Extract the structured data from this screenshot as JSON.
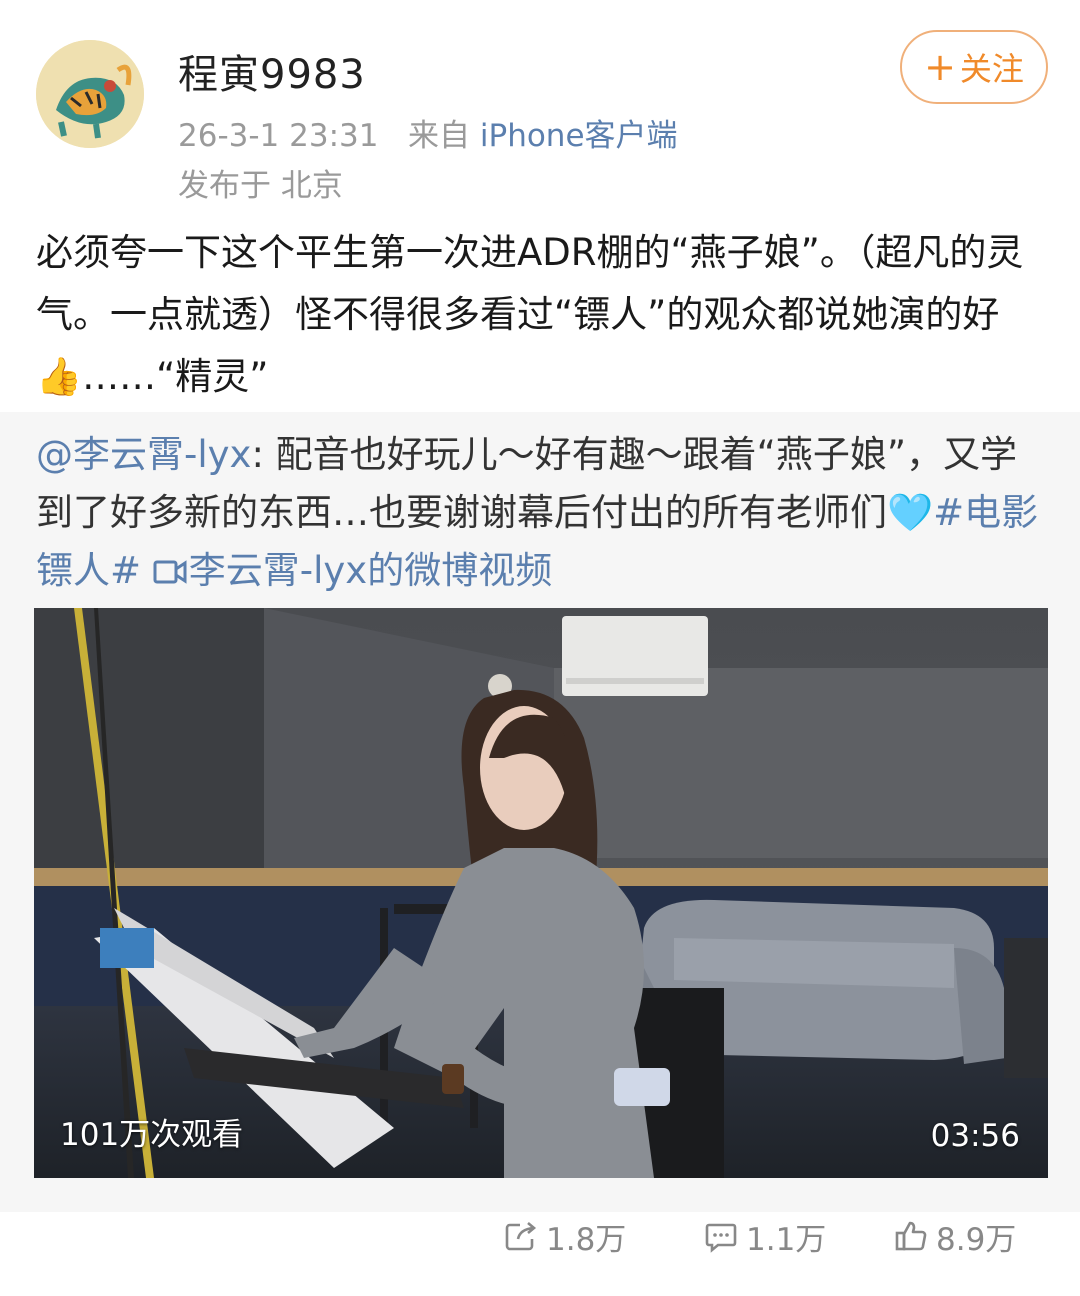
{
  "header": {
    "username": "程寅9983",
    "timestamp": "26-3-1 23:31",
    "source_prefix": "来自",
    "source": "iPhone客户端",
    "location": "发布于 北京",
    "follow_label": "关注",
    "follow_icon": "plus-icon"
  },
  "post": {
    "text": "必须夸一下这个平生第一次进ADR棚的“燕子娘”。（超凡的灵气。一点就透）怪不得很多看过“镖人”的观众都说她演的好",
    "emoji": "👍",
    "text_tail": "……“精灵”"
  },
  "repost": {
    "mention": "@李云霄-lyx",
    "text": ": 配音也好玩儿～好有趣～跟着“燕子娘”，又学到了好多新的东西…也要谢谢幕后付出的所有老师们",
    "emoji": "🩵",
    "hashtag": "#电影镖人#",
    "video_link": "李云霄-lyx的微博视频",
    "video_link_icon": "video-icon"
  },
  "video": {
    "views": "101万次观看",
    "duration": "03:56"
  },
  "actions": {
    "repost_count": "1.8万",
    "comment_count": "1.1万",
    "like_count": "8.9万"
  },
  "colors": {
    "link": "#5b7fae",
    "follow_accent": "#f08a2a",
    "meta_gray": "#9a9a9a",
    "repost_bg": "#f6f6f6"
  }
}
